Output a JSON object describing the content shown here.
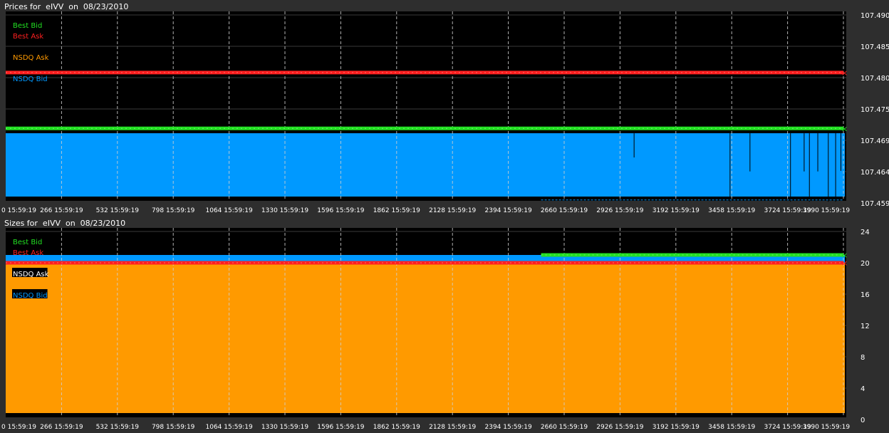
{
  "colors": {
    "best_bid": "#22e022",
    "best_ask": "#ff2020",
    "nsdq_ask": "#ff9a00",
    "nsdq_bid": "#0099ff",
    "background": "#000000",
    "frame": "#2e2e2e"
  },
  "chart_data": [
    {
      "type": "area",
      "title": "Prices for  eIVV  on  08/23/2010",
      "legend": {
        "placement": "top-left",
        "entries": [
          {
            "name": "Best Bid",
            "color": "#22e022"
          },
          {
            "name": "Best Ask",
            "color": "#ff2020"
          },
          {
            "name": "NSDQ Ask",
            "color": "#ff9a00"
          },
          {
            "name": "NSDQ Bid",
            "color": "#0099ff"
          }
        ]
      },
      "grid": true,
      "ylim": [
        107.459,
        107.49
      ],
      "yticks": [
        "107.490",
        "107.485",
        "107.480",
        "107.475",
        "107.469",
        "107.464",
        "107.459"
      ],
      "xlim": [
        0,
        4000
      ],
      "xticks": [
        {
          "value": 0,
          "label": "0 15:59:19"
        },
        {
          "value": 266,
          "label": "266 15:59:19"
        },
        {
          "value": 532,
          "label": "532 15:59:19"
        },
        {
          "value": 798,
          "label": "798 15:59:19"
        },
        {
          "value": 1064,
          "label": "1064 15:59:19"
        },
        {
          "value": 1330,
          "label": "1330 15:59:19"
        },
        {
          "value": 1596,
          "label": "1596 15:59:19"
        },
        {
          "value": 1862,
          "label": "1862 15:59:19"
        },
        {
          "value": 2128,
          "label": "2128 15:59:19"
        },
        {
          "value": 2394,
          "label": "2394 15:59:19"
        },
        {
          "value": 2660,
          "label": "2660 15:59:19"
        },
        {
          "value": 2926,
          "label": "2926 15:59:19"
        },
        {
          "value": 3192,
          "label": "3192 15:59:19"
        },
        {
          "value": 3458,
          "label": "3458 15:59:19"
        },
        {
          "value": 3724,
          "label": "3724 15:59:19"
        },
        {
          "value": 3990,
          "label": "3990 15:59:19"
        }
      ],
      "series": [
        {
          "name": "Best Ask",
          "style": "line",
          "color": "#ff2020",
          "x": [
            0,
            3990
          ],
          "y": [
            107.4805,
            107.4805
          ]
        },
        {
          "name": "Best Bid",
          "style": "line",
          "color": "#22e022",
          "x": [
            0,
            3990
          ],
          "y": [
            107.4713,
            107.4713
          ]
        },
        {
          "name": "NSDQ Bid",
          "style": "area",
          "color": "#0099ff",
          "x": [
            0,
            3990
          ],
          "y": [
            107.4705,
            107.4705
          ]
        }
      ],
      "dips": {
        "color": "#000000",
        "x": [
          2993,
          3450,
          3545,
          3738,
          3803,
          3828,
          3868,
          3918,
          3953,
          3978
        ],
        "y": [
          107.4665,
          107.4592,
          107.4642,
          107.4592,
          107.4642,
          107.4592,
          107.4642,
          107.4592,
          107.4592,
          107.4643
        ]
      },
      "baseline_trace": {
        "color": "#0099ff",
        "x_start": 2550,
        "x_end": 3990,
        "y": 107.4595
      }
    },
    {
      "type": "area",
      "title": "Sizes for  eIVV  on  08/23/2010",
      "legend": {
        "placement": "top-left",
        "entries": [
          {
            "name": "Best Bid",
            "color": "#22e022"
          },
          {
            "name": "Best Ask",
            "color": "#ff2020"
          },
          {
            "name": "NSDQ Ask",
            "color": "#ffffff"
          },
          {
            "name": "NSDQ Bid",
            "color": "#0099ff"
          }
        ]
      },
      "grid": true,
      "ylim": [
        0,
        24
      ],
      "yticks": [
        "24",
        "20",
        "16",
        "12",
        "8",
        "4",
        "0"
      ],
      "xlim": [
        0,
        4000
      ],
      "xticks": [
        {
          "value": 0,
          "label": "0 15:59:19"
        },
        {
          "value": 266,
          "label": "266 15:59:19"
        },
        {
          "value": 532,
          "label": "532 15:59:19"
        },
        {
          "value": 798,
          "label": "798 15:59:19"
        },
        {
          "value": 1064,
          "label": "1064 15:59:19"
        },
        {
          "value": 1330,
          "label": "1330 15:59:19"
        },
        {
          "value": 1596,
          "label": "1596 15:59:19"
        },
        {
          "value": 1862,
          "label": "1862 15:59:19"
        },
        {
          "value": 2128,
          "label": "2128 15:59:19"
        },
        {
          "value": 2394,
          "label": "2394 15:59:19"
        },
        {
          "value": 2660,
          "label": "2660 15:59:19"
        },
        {
          "value": 2926,
          "label": "2926 15:59:19"
        },
        {
          "value": 3192,
          "label": "3192 15:59:19"
        },
        {
          "value": 3458,
          "label": "3458 15:59:19"
        },
        {
          "value": 3724,
          "label": "3724 15:59:19"
        },
        {
          "value": 3990,
          "label": "3990 15:59:19"
        }
      ],
      "series": [
        {
          "name": "NSDQ Bid",
          "style": "area",
          "color": "#0099ff",
          "x": [
            0,
            3990
          ],
          "y": [
            21,
            21
          ]
        },
        {
          "name": "NSDQ Ask",
          "style": "area",
          "color": "#ff9a00",
          "x": [
            0,
            3990
          ],
          "y": [
            20,
            20
          ]
        },
        {
          "name": "Best Ask",
          "style": "line",
          "color": "#ff2020",
          "x": [
            0,
            3990
          ],
          "y": [
            20,
            20
          ]
        },
        {
          "name": "Best Bid",
          "style": "line",
          "color": "#22e022",
          "x": [
            2550,
            3990
          ],
          "y": [
            21,
            21
          ]
        }
      ]
    }
  ]
}
